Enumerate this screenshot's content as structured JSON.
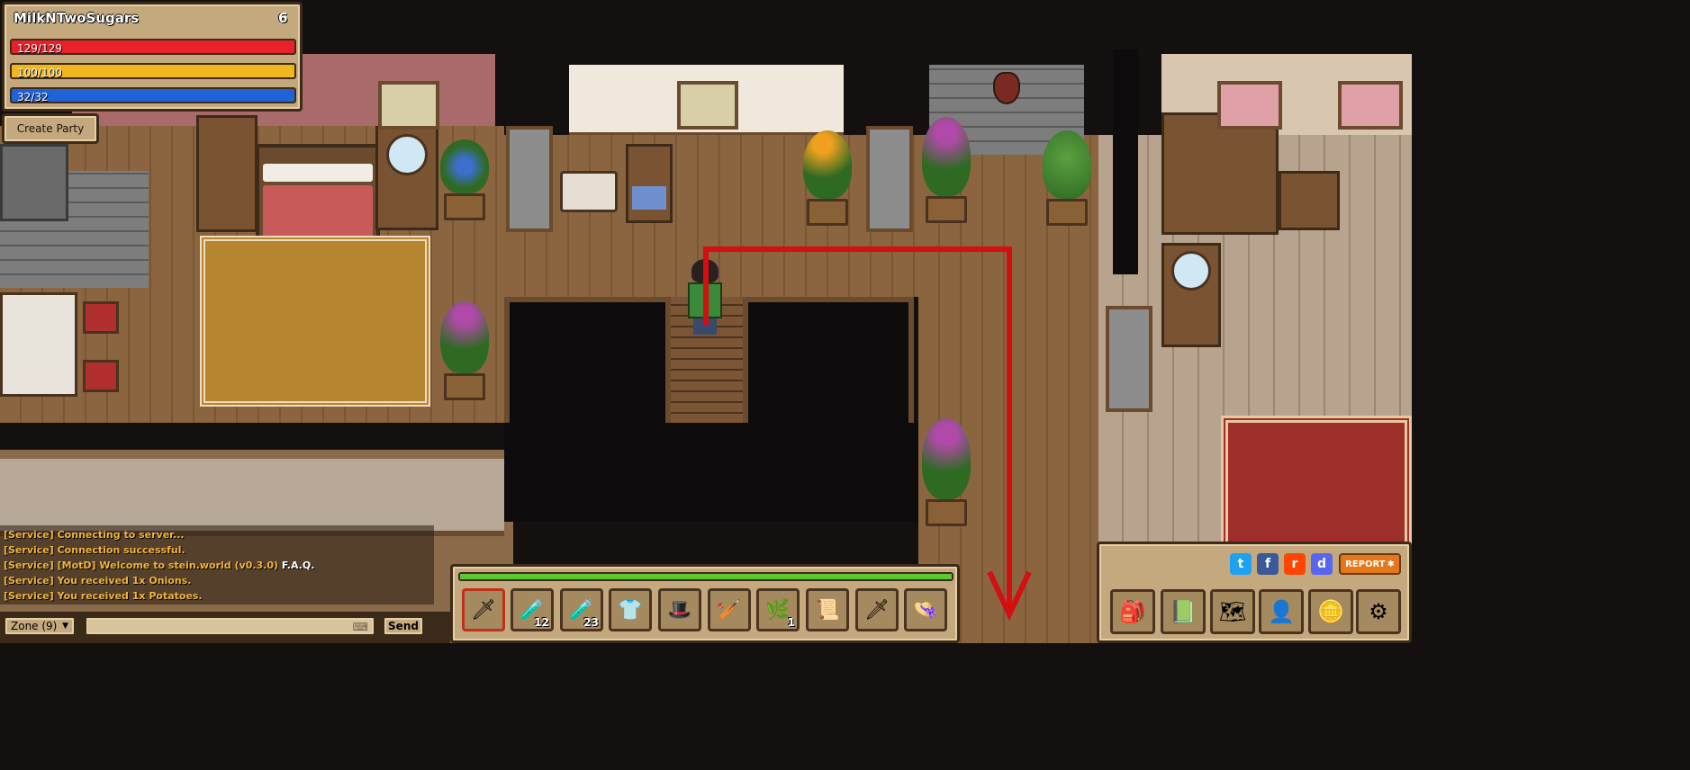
{
  "player": {
    "name": "MilkNTwoSugars",
    "level": "6",
    "health": "129/129",
    "health_pct": 1.0,
    "stamina": "100/100",
    "stamina_pct": 1.0,
    "mana": "32/32",
    "mana_pct": 1.0
  },
  "party": {
    "create_label": "Create Party"
  },
  "chat": {
    "lines": [
      "[Service] Connecting to server...",
      "[Service] Connection successful.",
      "[Service] [MotD] Welcome to stein.world (v0.3.0)",
      "[Service] You received 1x Onions.",
      "[Service] You received 1x Potatoes."
    ],
    "faq_link": "F.A.Q.",
    "channel": "Zone (9)",
    "input_value": "",
    "send_label": "Send"
  },
  "hotbar": {
    "xp_pct": 1.0,
    "slots": [
      {
        "icon": "sword-icon",
        "glyph": "🗡",
        "count": ""
      },
      {
        "icon": "health-potion-icon",
        "glyph": "🧪",
        "count": "12"
      },
      {
        "icon": "potion-icon",
        "glyph": "🧪",
        "count": "23"
      },
      {
        "icon": "tunic-icon",
        "glyph": "👕",
        "count": ""
      },
      {
        "icon": "hat-icon",
        "glyph": "🎩",
        "count": ""
      },
      {
        "icon": "club-icon",
        "glyph": "🏏",
        "count": ""
      },
      {
        "icon": "herb-icon",
        "glyph": "🌿",
        "count": "1"
      },
      {
        "icon": "map-scroll-icon",
        "glyph": "📜",
        "count": ""
      },
      {
        "icon": "sword-icon",
        "glyph": "🗡",
        "count": ""
      },
      {
        "icon": "straw-hat-icon",
        "glyph": "👒",
        "count": ""
      }
    ]
  },
  "social": {
    "twitter": "t",
    "facebook": "f",
    "reddit": "r",
    "discord": "d",
    "report_label": "REPORT"
  },
  "menu": [
    {
      "icon": "bag-icon",
      "glyph": "🎒"
    },
    {
      "icon": "quest-book-icon",
      "glyph": "📗"
    },
    {
      "icon": "world-map-icon",
      "glyph": "🗺"
    },
    {
      "icon": "character-icon",
      "glyph": "👤"
    },
    {
      "icon": "gold-coins-icon",
      "glyph": "🪙"
    },
    {
      "icon": "settings-gear-icon",
      "glyph": "⚙"
    }
  ],
  "colors": {
    "health": "#e8212b",
    "stamina": "#f0b61e",
    "mana": "#1f63d6",
    "path": "#d40f0f"
  }
}
